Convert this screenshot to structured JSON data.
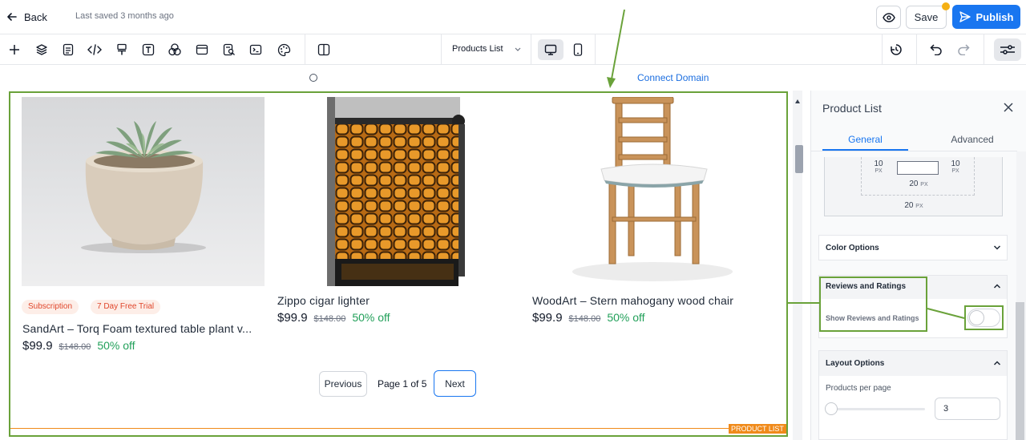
{
  "header": {
    "back_label": "Back",
    "saved_status": "Last saved 3 months ago",
    "save_label": "Save",
    "publish_label": "Publish"
  },
  "toolbar": {
    "page_select": "Products List",
    "icons": [
      "add-icon",
      "layers-icon",
      "pages-icon",
      "code-icon",
      "paint-icon",
      "text-icon",
      "color-mix-icon",
      "section-icon",
      "page-search-icon",
      "terminal-icon",
      "palette-icon",
      "split-view-icon",
      "desktop-icon",
      "mobile-icon",
      "history-icon",
      "undo-icon",
      "redo-icon",
      "settings-sliders-icon"
    ]
  },
  "domain": {
    "connect_label": "Connect Domain"
  },
  "products": [
    {
      "name": "SandArt – Torq Foam textured table plant v...",
      "price": "$99.9",
      "old_price": "$148.00",
      "discount": "50% off",
      "badges": [
        "Subscription",
        "7 Day Free Trial"
      ]
    },
    {
      "name": "Zippo cigar lighter",
      "price": "$99.9",
      "old_price": "$148.00",
      "discount": "50% off"
    },
    {
      "name": "WoodArt – Stern mahogany wood chair",
      "price": "$99.9",
      "old_price": "$148.00",
      "discount": "50% off"
    }
  ],
  "pagination": {
    "previous": "Previous",
    "page_info": "Page 1 of 5",
    "next": "Next"
  },
  "element_tag": "PRODUCT LIST",
  "panel": {
    "title": "Product List",
    "tabs": [
      "General",
      "Advanced"
    ],
    "spacing": {
      "left": "10",
      "right": "10",
      "inner_bottom": "20",
      "outer_bottom": "20",
      "unit": "PX"
    },
    "sections": {
      "color_options": "Color Options",
      "reviews": "Reviews and Ratings",
      "show_reviews": "Show Reviews and Ratings",
      "show_reviews_enabled": false,
      "layout": "Layout Options",
      "products_per_page_label": "Products per page",
      "products_per_page": "3"
    }
  },
  "colors": {
    "accent": "#1976f0",
    "annotation": "#6aa23a",
    "discount": "#22a05a",
    "tag": "#f08a1a",
    "badge_text": "#e0462b"
  }
}
